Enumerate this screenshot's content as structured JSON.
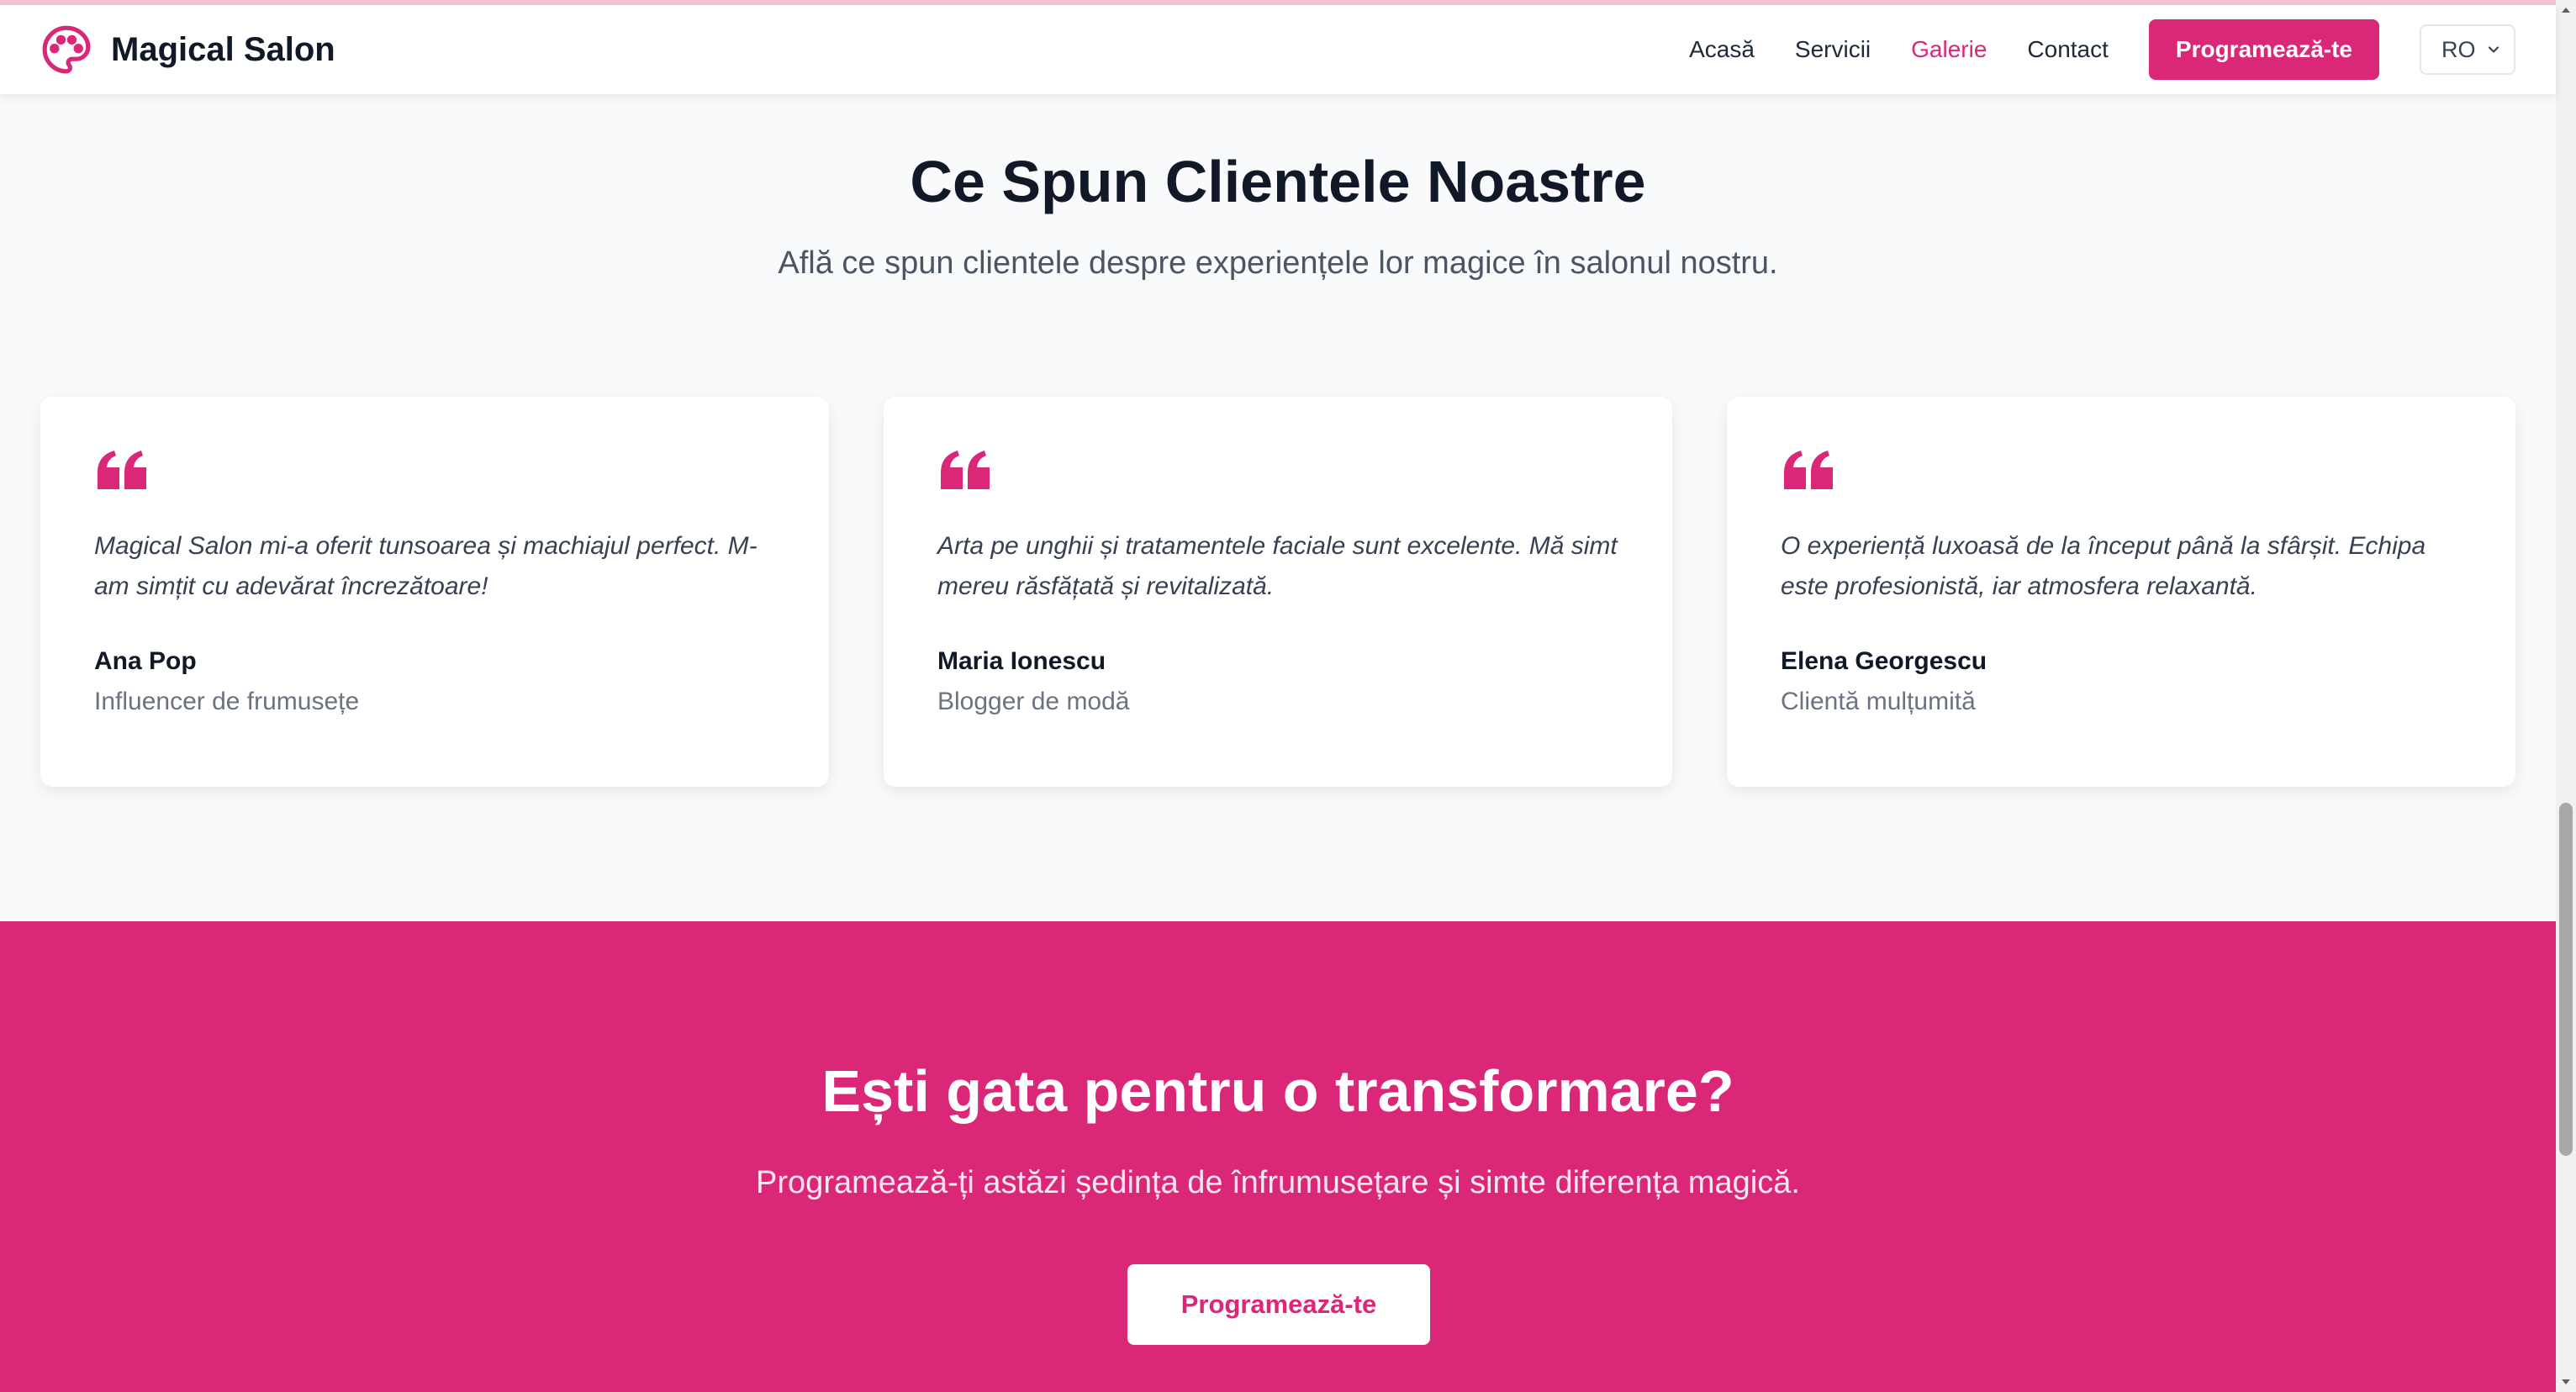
{
  "brand": {
    "name": "Magical Salon",
    "accent_color": "#db2777",
    "icon": "palette-icon"
  },
  "nav": {
    "links": [
      {
        "label": "Acasă",
        "active": false
      },
      {
        "label": "Servicii",
        "active": false
      },
      {
        "label": "Galerie",
        "active": true
      },
      {
        "label": "Contact",
        "active": false
      }
    ],
    "cta_label": "Programează-te",
    "language": {
      "selected": "RO",
      "icon": "chevron-down-icon"
    }
  },
  "testimonials": {
    "title": "Ce Spun Clientele Noastre",
    "subtitle": "Află ce spun clientele despre experiențele lor magice în salonul nostru.",
    "items": [
      {
        "quote": "Magical Salon mi-a oferit tunsoarea și machiajul perfect. M-am simțit cu adevărat încrezătoare!",
        "name": "Ana Pop",
        "role": "Influencer de frumusețe"
      },
      {
        "quote": "Arta pe unghii și tratamentele faciale sunt excelente. Mă simt mereu răsfățată și revitalizată.",
        "name": "Maria Ionescu",
        "role": "Blogger de modă"
      },
      {
        "quote": "O experiență luxoasă de la început până la sfârșit. Echipa este profesionistă, iar atmosfera relaxantă.",
        "name": "Elena Georgescu",
        "role": "Clientă mulțumită"
      }
    ]
  },
  "cta": {
    "title": "Ești gata pentru o transformare?",
    "text": "Programează-ți astăzi ședința de înfrumusețare și simte diferența magică.",
    "button_label": "Programează-te",
    "background": "#db2777"
  }
}
